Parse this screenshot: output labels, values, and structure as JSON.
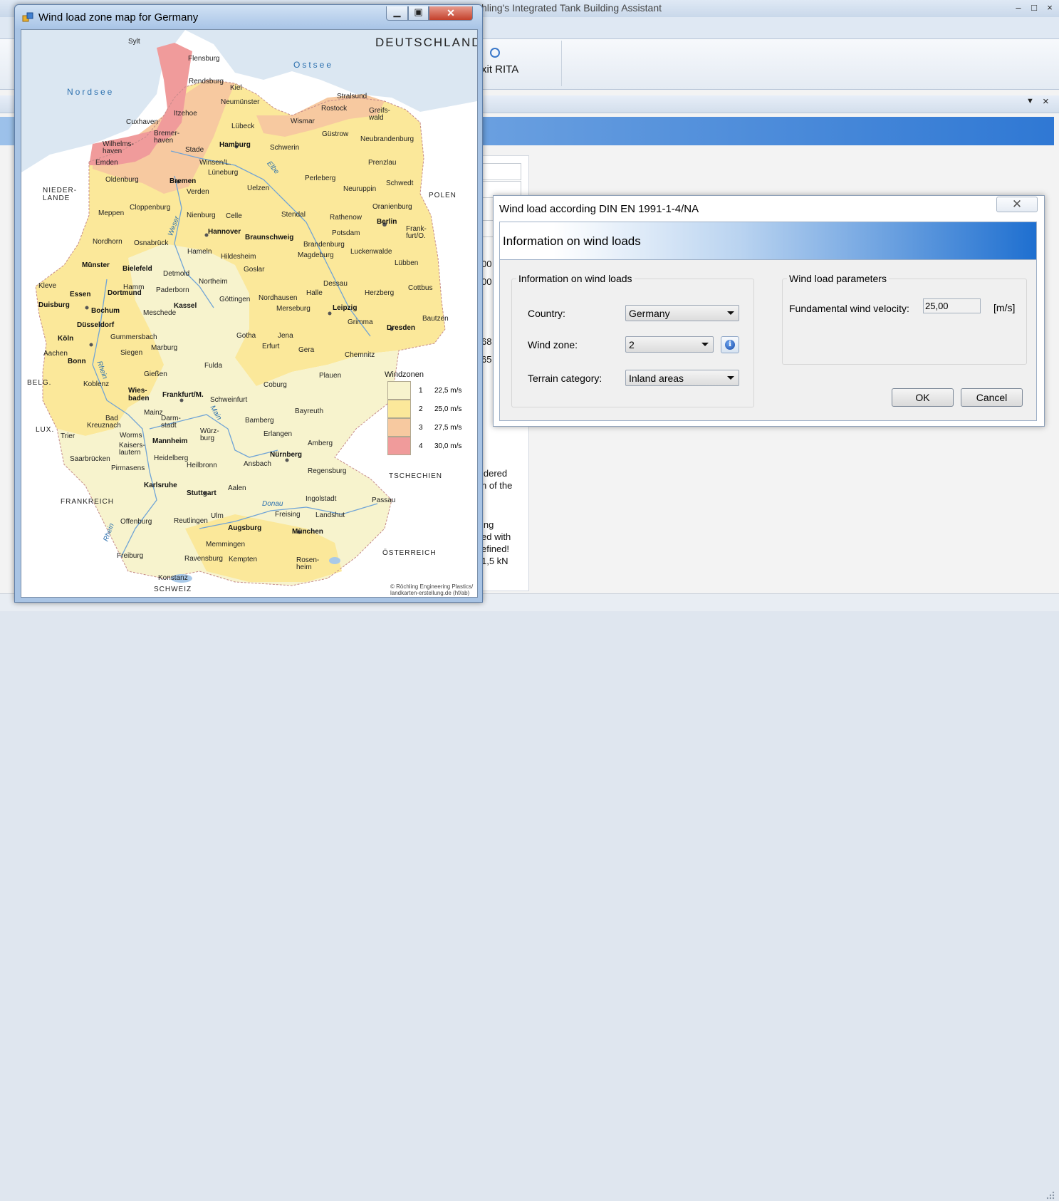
{
  "main_window": {
    "title": "hling's Integrated Tank Building Assistant",
    "controls": {
      "minimize": "‒",
      "maximize": "□",
      "close": "×"
    },
    "ribbon": {
      "exit_label": "xit RITA"
    },
    "doc_bar": {
      "dropdown": "▼",
      "close": "×"
    },
    "ghost_values": [
      "00",
      "00",
      "68",
      "65"
    ],
    "ghost_text_lines": [
      "idered",
      "n of the",
      "ing",
      "ed with",
      "efined!",
      "1,5 kN"
    ]
  },
  "map_window": {
    "title": "Wind load zone map for Germany",
    "controls": {
      "minimize": "▁",
      "maximize": "▣",
      "close": "✕"
    },
    "map": {
      "heading": "DEUTSCHLAND",
      "seas": [
        "Nordsee",
        "Ostsee"
      ],
      "countries": [
        "NIEDER-",
        "LANDE",
        "POLEN",
        "BELG.",
        "LUX.",
        "FRANKREICH",
        "TSCHECHIEN",
        "ÖSTERREICH",
        "SCHWEIZ"
      ],
      "rivers": [
        "Elbe",
        "Weser",
        "Rhein",
        "Main",
        "Donau",
        "Rhein"
      ],
      "cities_bold": [
        "Hamburg",
        "Bremen",
        "Hannover",
        "Braunschweig",
        "Berlin",
        "Münster",
        "Bielefeld",
        "Dortmund",
        "Essen",
        "Duisburg",
        "Bochum",
        "Düsseldorf",
        "Köln",
        "Bonn",
        "Kassel",
        "Leipzig",
        "Dresden",
        "Frankfurt/M.",
        "Wies-",
        "baden",
        "Mannheim",
        "Karlsruhe",
        "Stuttgart",
        "Nürnberg",
        "Augsburg",
        "München"
      ],
      "cities": [
        "Sylt",
        "Flensburg",
        "Kiel",
        "Rendsburg",
        "Neumünster",
        "Itzehoe",
        "Lübeck",
        "Stralsund",
        "Rostock",
        "Greifs-",
        "wald",
        "Wismar",
        "Cuxhaven",
        "Bremer-",
        "haven",
        "Wilhelms-",
        "haven",
        "Emden",
        "Stade",
        "Güstrow",
        "Neubrandenburg",
        "Schwerin",
        "Winsen/L.",
        "Lüneburg",
        "Oldenburg",
        "Verden",
        "Uelzen",
        "Perleberg",
        "Prenzlau",
        "Neuruppin",
        "Schwedt",
        "Cloppenburg",
        "Meppen",
        "Nienburg",
        "Celle",
        "Stendal",
        "Oranienburg",
        "Rathenow",
        "Potsdam",
        "Frank-",
        "furt/O.",
        "Nordhorn",
        "Osnabrück",
        "Brandenburg",
        "Luckenwalde",
        "Magdeburg",
        "Hildesheim",
        "Hameln",
        "Lübben",
        "Goslar",
        "Detmold",
        "Northeim",
        "Dessau",
        "Cottbus",
        "Kleve",
        "Hamm",
        "Paderborn",
        "Halle",
        "Herzberg",
        "Göttingen",
        "Nordhausen",
        "Merseburg",
        "Meschede",
        "Grimma",
        "Bautzen",
        "Gummersbach",
        "Gotha",
        "Jena",
        "Erfurt",
        "Gera",
        "Chemnitz",
        "Aachen",
        "Siegen",
        "Marburg",
        "Plauen",
        "Gießen",
        "Fulda",
        "Koblenz",
        "Coburg",
        "Schweinfurt",
        "Mainz",
        "Bayreuth",
        "Bad",
        "Kreuznach",
        "Darm-",
        "stadt",
        "Bamberg",
        "Trier",
        "Worms",
        "Würz-",
        "burg",
        "Erlangen",
        "Amberg",
        "Kaisers-",
        "lautern",
        "Saarbrücken",
        "Heidelberg",
        "Ansbach",
        "Pirmasens",
        "Heilbronn",
        "Regensburg",
        "Aalen",
        "Ingolstadt",
        "Passau",
        "Landshut",
        "Offenburg",
        "Reutlingen",
        "Ulm",
        "Freising",
        "Memmingen",
        "Freiburg",
        "Ravensburg",
        "Kempten",
        "Rosen-",
        "heim",
        "Konstanz"
      ],
      "legend": {
        "title": "Windzonen",
        "entries": [
          {
            "zone": "1",
            "value": "22,5 m/s",
            "color": "#f7f3cd"
          },
          {
            "zone": "2",
            "value": "25,0 m/s",
            "color": "#fbe89a"
          },
          {
            "zone": "3",
            "value": "27,5 m/s",
            "color": "#f7c9a0"
          },
          {
            "zone": "4",
            "value": "30,0 m/s",
            "color": "#f09b9b"
          }
        ]
      },
      "copyright_line1": "© Röchling Engineering Plastics/",
      "copyright_line2": "landkarten-erstellung.de (hf/ab)"
    }
  },
  "wind_dialog": {
    "title": "Wind load according DIN EN 1991-1-4/NA",
    "close": "✕",
    "header": "Information on wind loads",
    "info_group": {
      "title": "Information on wind loads",
      "country_label": "Country:",
      "country_value": "Germany",
      "wind_zone_label": "Wind zone:",
      "wind_zone_value": "2",
      "info_icon_glyph": "i",
      "terrain_label": "Terrain category:",
      "terrain_value": "Inland areas"
    },
    "params_group": {
      "title": "Wind load parameters",
      "velocity_label": "Fundamental wind velocity:",
      "velocity_value": "25,00",
      "velocity_unit": "[m/s]"
    },
    "ok_label": "OK",
    "cancel_label": "Cancel"
  }
}
